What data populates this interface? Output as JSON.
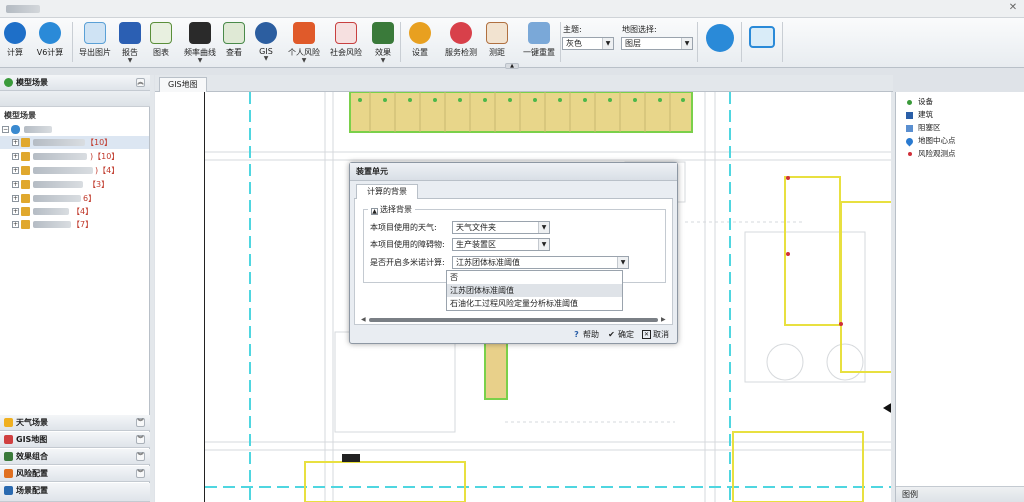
{
  "toolbar": {
    "items": [
      {
        "label": "计算",
        "color": "#1e6fc8"
      },
      {
        "label": "V6计算",
        "color": "#2a8ad8"
      },
      {
        "label": "导出图片",
        "color": "#5aa0d6"
      },
      {
        "label": "报告",
        "color": "#2b5fb3"
      },
      {
        "label": "图表",
        "color": "#5a8f3a"
      },
      {
        "label": "频率曲线",
        "color": "#2a2a2a"
      },
      {
        "label": "查看",
        "color": "#4a8a4a"
      },
      {
        "label": "GIS",
        "color": "#2c5ea0"
      },
      {
        "label": "个人风险",
        "color": "#e05a2a"
      },
      {
        "label": "社会风险",
        "color": "#c84040"
      },
      {
        "label": "效果",
        "color": "#3a7a3a"
      },
      {
        "label": "设置",
        "color": "#e8a020"
      },
      {
        "label": "服务检测",
        "color": "#d8404a"
      },
      {
        "label": "测距",
        "color": "#b07040"
      },
      {
        "label": "一键重置",
        "color": "#7aa8d8"
      }
    ],
    "theme_label": "主题:",
    "theme_value": "灰色",
    "map_select_label": "地图选择:",
    "map_select_value": "图层"
  },
  "left_panel": {
    "header": "模型场景",
    "tree_title": "模型场景",
    "tree_items": [
      {
        "count": "【10】"
      },
      {
        "count": ")【10】"
      },
      {
        "count": ")【4】"
      },
      {
        "count": "【3】"
      },
      {
        "count": "6】"
      },
      {
        "count": "【4】"
      },
      {
        "count": "【7】"
      }
    ],
    "bottom_sections": [
      "天气场景",
      "GIS地图",
      "效果组合",
      "风险配置",
      "场景配置"
    ]
  },
  "center": {
    "tab": "GIS地图"
  },
  "legend": {
    "items": [
      {
        "label": "设备",
        "color": "#3a9a3a"
      },
      {
        "label": "建筑",
        "color": "#2a5fa8"
      },
      {
        "label": "阻塞区",
        "color": "#5a8fd0"
      },
      {
        "label": "地图中心点",
        "color": "#2a7ad0"
      },
      {
        "label": "风险观测点",
        "color": "#d0303a"
      }
    ],
    "footer": "图例"
  },
  "dialog": {
    "title": "装置单元",
    "tab": "计算的背景",
    "group_title": "选择背景",
    "fields": [
      {
        "label": "本项目使用的天气:",
        "value": "天气文件夹"
      },
      {
        "label": "本项目使用的障碍物:",
        "value": "生产装置区"
      },
      {
        "label": "是否开启多米诺计算:",
        "value": "江苏团体标准阈值"
      }
    ],
    "dropdown_options": [
      "否",
      "江苏团体标准阈值",
      "石油化工过程风险定量分析标准阈值"
    ],
    "buttons": {
      "help": "帮助",
      "ok": "确定",
      "cancel": "取消"
    }
  }
}
